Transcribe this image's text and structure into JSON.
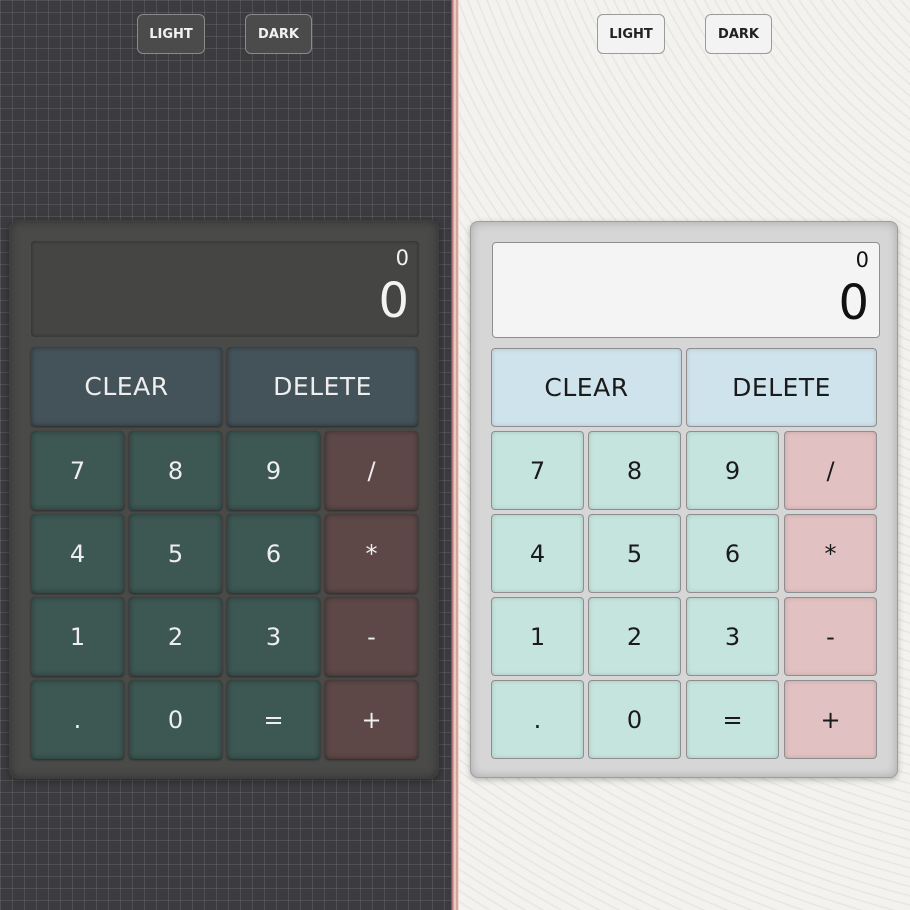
{
  "theme_buttons": {
    "light_label": "LIGHT",
    "dark_label": "DARK"
  },
  "dark_calculator": {
    "display": {
      "previous": "0",
      "current": "0"
    },
    "function_keys": [
      "CLEAR",
      "DELETE"
    ],
    "keypad_rows": [
      [
        "7",
        "8",
        "9",
        "/"
      ],
      [
        "4",
        "5",
        "6",
        "*"
      ],
      [
        "1",
        "2",
        "3",
        "-"
      ],
      [
        ".",
        "0",
        "=",
        "+"
      ]
    ]
  },
  "light_calculator": {
    "display": {
      "previous": "0",
      "current": "0"
    },
    "function_keys": [
      "CLEAR",
      "DELETE"
    ],
    "keypad_rows": [
      [
        "7",
        "8",
        "9",
        "/"
      ],
      [
        "4",
        "5",
        "6",
        "*"
      ],
      [
        "1",
        "2",
        "3",
        "-"
      ],
      [
        ".",
        "0",
        "=",
        "+"
      ]
    ]
  },
  "colors": {
    "dark_background": "#3c3c40",
    "dark_function_key": "#44525a",
    "dark_number_key": "#3d5753",
    "dark_operator_key": "#5d4847",
    "light_background": "#f4f2ef",
    "light_function_key": "#cfe3ec",
    "light_number_key": "#c6e4de",
    "light_operator_key": "#e2c1c2"
  }
}
